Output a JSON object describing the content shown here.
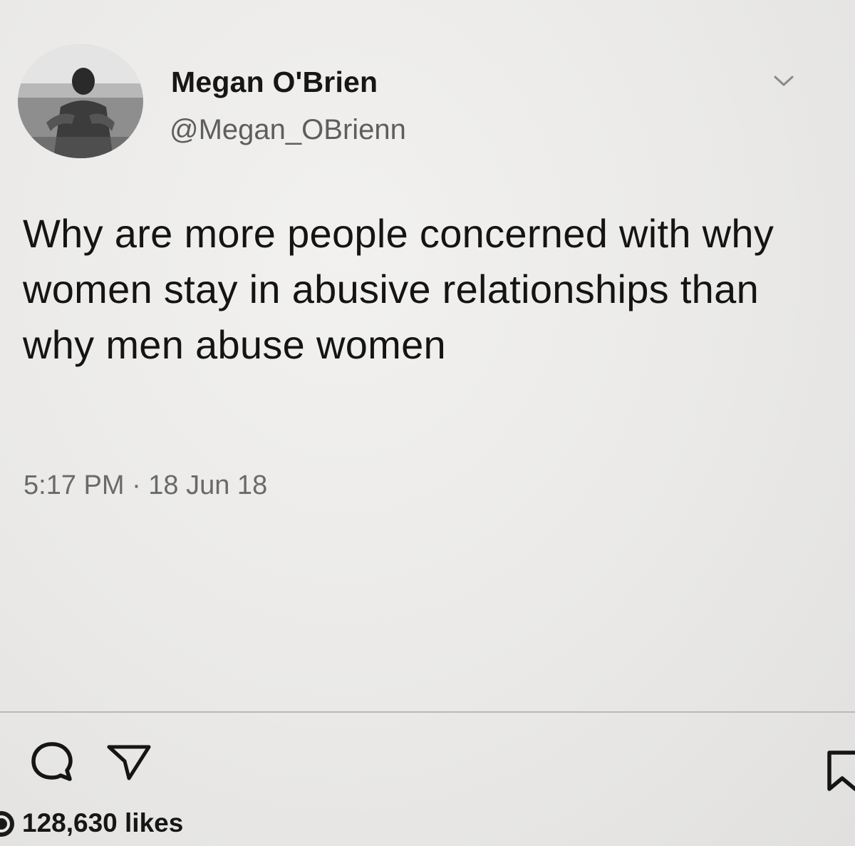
{
  "post": {
    "author": {
      "display_name": "Megan O'Brien",
      "handle": "@Megan_OBrienn"
    },
    "text": "Why are more people concerned with why women stay in abusive relationships than why men abuse women",
    "timestamp": "5:17 PM · 18 Jun 18"
  },
  "icons": {
    "menu": "chevron-down-icon",
    "comment": "comment-icon",
    "share": "share-icon",
    "bookmark": "bookmark-icon"
  },
  "engagement": {
    "likes": "128,630 likes"
  },
  "colors": {
    "background": "#eae9e7",
    "text": "#141414",
    "secondary_text": "#5e5e5e"
  }
}
